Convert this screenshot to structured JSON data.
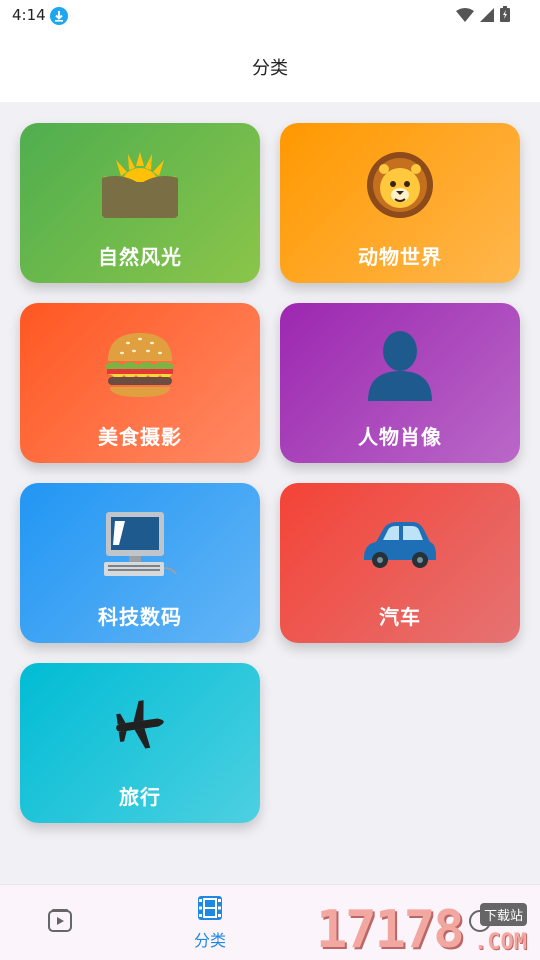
{
  "status_bar": {
    "time": "4:14"
  },
  "app_bar": {
    "title": "分类"
  },
  "categories": [
    {
      "label": "自然风光",
      "icon": "sunrise-over-mountains-icon"
    },
    {
      "label": "动物世界",
      "icon": "lion-face-icon"
    },
    {
      "label": "美食摄影",
      "icon": "hamburger-icon"
    },
    {
      "label": "人物肖像",
      "icon": "person-silhouette-icon"
    },
    {
      "label": "科技数码",
      "icon": "desktop-computer-icon"
    },
    {
      "label": "汽车",
      "icon": "car-icon"
    },
    {
      "label": "旅行",
      "icon": "airplane-icon"
    }
  ],
  "bottom_nav": {
    "active_color": "#1e88e5",
    "items": [
      {
        "label": "",
        "icon": "video-icon"
      },
      {
        "label": "分类",
        "icon": "film-icon"
      },
      {
        "label": "",
        "icon": "circle-icon"
      }
    ]
  },
  "watermark": {
    "digits": "17178",
    "suffix": ".COM",
    "tag": "下载站"
  }
}
